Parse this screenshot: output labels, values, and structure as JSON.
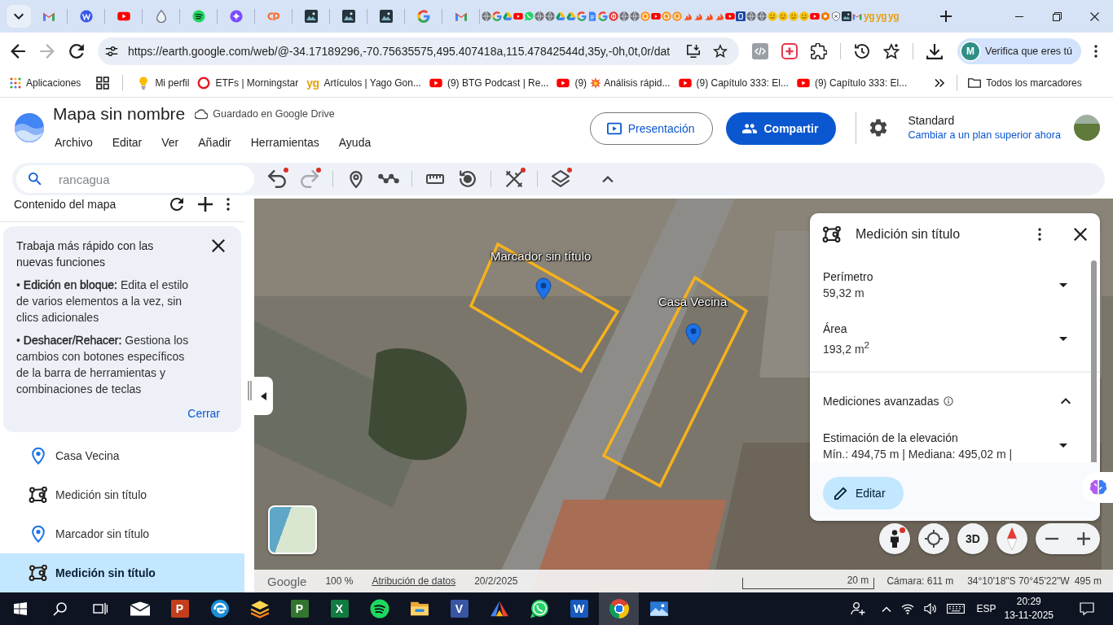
{
  "browser": {
    "pinned_tabs": [
      {
        "kind": "gmail"
      },
      {
        "kind": "wordpress"
      },
      {
        "kind": "youtube"
      },
      {
        "kind": "drop"
      },
      {
        "kind": "spotify"
      },
      {
        "kind": "sparkle"
      },
      {
        "kind": "cpanel"
      },
      {
        "kind": "thumbnail"
      },
      {
        "kind": "thumbnail"
      },
      {
        "kind": "thumbnail"
      },
      {
        "kind": "google"
      },
      {
        "kind": "gmail"
      }
    ],
    "compact_tabs": [
      {
        "kind": "globe"
      },
      {
        "kind": "google"
      },
      {
        "kind": "drive"
      },
      {
        "kind": "youtube"
      },
      {
        "kind": "whatsapp"
      },
      {
        "kind": "globe"
      },
      {
        "kind": "globe"
      },
      {
        "kind": "drive"
      },
      {
        "kind": "drive"
      },
      {
        "kind": "google"
      },
      {
        "kind": "docs"
      },
      {
        "kind": "google"
      },
      {
        "kind": "dollar"
      },
      {
        "kind": "globe"
      },
      {
        "kind": "globe"
      },
      {
        "kind": "coin"
      },
      {
        "kind": "youtube"
      },
      {
        "kind": "coin"
      },
      {
        "kind": "coin"
      },
      {
        "kind": "bird"
      },
      {
        "kind": "bird"
      },
      {
        "kind": "bird"
      },
      {
        "kind": "bird"
      },
      {
        "kind": "youtube"
      },
      {
        "kind": "bank"
      },
      {
        "kind": "globe"
      },
      {
        "kind": "globe"
      },
      {
        "kind": "smile"
      },
      {
        "kind": "smile"
      },
      {
        "kind": "smile"
      },
      {
        "kind": "smile"
      },
      {
        "kind": "youtube"
      },
      {
        "kind": "hex"
      },
      {
        "kind": "shield"
      },
      {
        "kind": "thumbnail"
      },
      {
        "kind": "gmail"
      },
      {
        "kind": "letters",
        "text": "yg"
      },
      {
        "kind": "letters",
        "text": "yg"
      },
      {
        "kind": "letters",
        "text": "yg"
      }
    ],
    "nav_buttons": [
      {
        "kind": "back",
        "disabled": false
      },
      {
        "kind": "forward",
        "disabled": true
      },
      {
        "kind": "reload",
        "disabled": false
      }
    ],
    "address": {
      "url": "https://earth.google.com/web/@-34.17189296,-70.75635575,495.407418a,115.47842544d,35y,-0h,0t,0r/dat"
    },
    "profile": {
      "initial": "M",
      "label": "Verifica que eres tú"
    },
    "shortcuts": [
      {
        "kind": "apps",
        "label": "Aplicaciones"
      },
      {
        "kind": "grid"
      }
    ],
    "bookmarks": [
      {
        "kind": "bulb",
        "label": "Mi perfil",
        "burst_emoji": false
      },
      {
        "kind": "ring",
        "label": "ETFs | Morningstar",
        "burst_emoji": false
      },
      {
        "kind": "letters",
        "icon_text": "yg",
        "label": "Artículos | Yago Gon...",
        "burst_emoji": false
      },
      {
        "kind": "video",
        "count": "(9)",
        "label": "BTG Podcast | Re...",
        "burst_emoji": false
      },
      {
        "kind": "video",
        "count": "(9)",
        "burst_emoji": true,
        "label": "Análisis rápid..."
      },
      {
        "kind": "video",
        "count": "(9)",
        "label": "Capítulo 333: El...",
        "burst_emoji": false
      },
      {
        "kind": "video",
        "count": "(9)",
        "label": "Capítulo 333: El...",
        "burst_emoji": false
      }
    ],
    "all_bookmarks": "Todos los marcadores"
  },
  "app": {
    "title": "Mapa sin nombre",
    "save_status": "Guardado en Google Drive",
    "menu": [
      "Archivo",
      "Editar",
      "Ver",
      "Añadir",
      "Herramientas",
      "Ayuda"
    ],
    "present_button": "Presentación",
    "share_button": "Compartir",
    "plan": {
      "name": "Standard",
      "upgrade_link": "Cambiar a un plan superior ahora"
    }
  },
  "toolbar": {
    "search": {
      "placeholder": "rancagua"
    },
    "tool_groups": [
      [
        {
          "kind": "undo",
          "dot": true,
          "disabled": false
        },
        {
          "kind": "redo",
          "dot": true,
          "disabled": true
        }
      ],
      [
        {
          "kind": "placemark",
          "dot": false,
          "disabled": false
        },
        {
          "kind": "path",
          "dot": false,
          "disabled": false
        }
      ],
      [
        {
          "kind": "ruler",
          "dot": false,
          "disabled": false
        },
        {
          "kind": "history",
          "dot": false,
          "disabled": false
        }
      ],
      [
        {
          "kind": "tools",
          "dot": true,
          "disabled": false
        }
      ],
      [
        {
          "kind": "layers",
          "dot": true,
          "disabled": false
        }
      ]
    ],
    "collapse": {
      "expanded": true
    }
  },
  "sidebar": {
    "title": "Contenido del mapa",
    "tip": {
      "title": "Trabaja más rápido con las nuevas funciones",
      "paragraphs": [
        "• **Edición en bloque:** Edita el estilo de varios elementos a la vez, sin clics adicionales",
        "• **Deshacer/Rehacer:** Gestiona los cambios con botones específicos de la barra de herramientas y combinaciones de teclas"
      ],
      "close_button": "Cerrar"
    },
    "items": [
      {
        "kind": "placemark",
        "label": "Casa Vecina",
        "selected": false
      },
      {
        "kind": "measurement",
        "label": "Medición sin título",
        "selected": false
      },
      {
        "kind": "placemark",
        "label": "Marcador sin título",
        "selected": false
      },
      {
        "kind": "measurement",
        "label": "Medición sin título",
        "selected": true
      }
    ]
  },
  "map": {
    "placemarks": [
      {
        "label": "Marcador sin título"
      },
      {
        "label": "Casa Vecina"
      }
    ]
  },
  "measurement": {
    "title": "Medición sin título",
    "metrics": [
      {
        "label": "Perímetro",
        "value": "59,32 m",
        "expanded": false
      },
      {
        "label": "Área",
        "value": "193,2 m$^{2}$",
        "expanded": false
      }
    ],
    "advanced": {
      "title": "Mediciones avanzadas",
      "expanded": true,
      "items": [
        {
          "label": "Estimación de la elevación",
          "value": "Mín.: 494,75 m | Mediana: 495,02 m |",
          "expanded": false
        }
      ]
    },
    "edit_button": "Editar"
  },
  "map_controls": {
    "pegman": {
      "dot": true
    },
    "view_3d": "3D"
  },
  "map_status": {
    "logo": "Google",
    "zoom": "100 %",
    "attribution": "Atribución de datos",
    "date": "20/2/2025",
    "scale": "20 m",
    "camera": "Cámara: 611 m",
    "coordinates": "34°10'18\"S 70°45'22\"W",
    "altitude": "495 m"
  },
  "taskbar": {
    "apps": [
      {
        "kind": "mail",
        "selected": false
      },
      {
        "kind": "powerpoint",
        "letter": "P",
        "selected": false
      },
      {
        "kind": "edge",
        "selected": false
      },
      {
        "kind": "stack",
        "selected": false
      },
      {
        "kind": "project",
        "letter": "P",
        "selected": false
      },
      {
        "kind": "excel",
        "letter": "X",
        "selected": false
      },
      {
        "kind": "spotify",
        "selected": false
      },
      {
        "kind": "explorer",
        "selected": false
      },
      {
        "kind": "visio",
        "letter": "V",
        "selected": false
      },
      {
        "kind": "arc",
        "selected": false
      },
      {
        "kind": "whatsapp",
        "selected": false
      },
      {
        "kind": "word",
        "letter": "W",
        "selected": false
      },
      {
        "kind": "chrome",
        "selected": true
      },
      {
        "kind": "photos",
        "selected": false
      }
    ],
    "language": "ESP",
    "time": "20:29",
    "date": "13-11-2025"
  }
}
